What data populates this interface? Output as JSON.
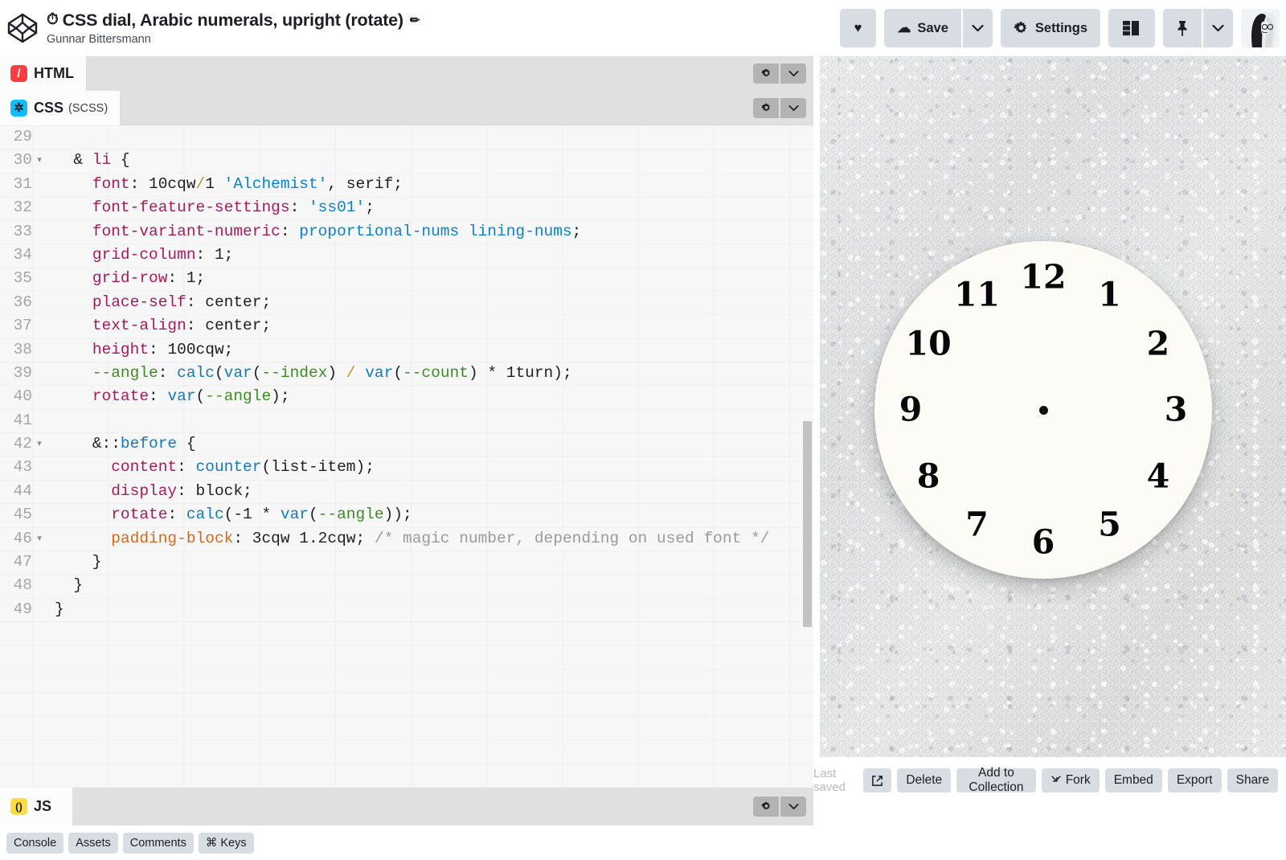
{
  "header": {
    "logo_icon": "codepen-logo-icon",
    "pen_title": "CSS dial, Arabic numerals, upright (rotate)",
    "stopwatch_icon": "⏱",
    "edit_icon": "✏",
    "author": "Gunnar Bittersmann",
    "actions": {
      "heart_icon": "♥",
      "save_label": "Save",
      "save_cloud_icon": "☁",
      "save_chevron": "⌄",
      "settings_label": "Settings",
      "settings_gear_icon": "✿",
      "layout_icon": "layout-icon",
      "pin_icon": "📌",
      "pin_chevron": "⌄",
      "avatar_alt": "user-avatar"
    }
  },
  "panes": [
    {
      "id": "html",
      "label": "HTML",
      "sub": "",
      "icon_glyph": "/",
      "icon_color": "#ff3c41"
    },
    {
      "id": "css",
      "label": "CSS",
      "sub": "(SCSS)",
      "icon_glyph": "✲",
      "icon_color": "#0ebeff"
    },
    {
      "id": "js",
      "label": "JS",
      "sub": "",
      "icon_glyph": "()",
      "icon_color": "#ffdd40"
    }
  ],
  "pane_controls": {
    "gear_icon": "✿",
    "chevron_icon": "⌄"
  },
  "editor": {
    "language": "SCSS",
    "first_line": 29,
    "lines": [
      {
        "n": 29,
        "fold": "",
        "tokens": []
      },
      {
        "n": 30,
        "fold": "▾",
        "tokens": [
          {
            "t": "  ",
            "c": "t-punct"
          },
          {
            "t": "&",
            "c": "t-punct"
          },
          {
            "t": " ",
            "c": "t-punct"
          },
          {
            "t": "li",
            "c": "t-sel"
          },
          {
            "t": " {",
            "c": "t-punct"
          }
        ]
      },
      {
        "n": 31,
        "fold": "",
        "tokens": [
          {
            "t": "    ",
            "c": "t-punct"
          },
          {
            "t": "font",
            "c": "t-prop"
          },
          {
            "t": ": ",
            "c": "t-punct"
          },
          {
            "t": "10cqw",
            "c": "t-num"
          },
          {
            "t": "/",
            "c": "t-op"
          },
          {
            "t": "1 ",
            "c": "t-num"
          },
          {
            "t": "'Alchemist'",
            "c": "t-str"
          },
          {
            "t": ", serif;",
            "c": "t-punct"
          }
        ]
      },
      {
        "n": 32,
        "fold": "",
        "tokens": [
          {
            "t": "    ",
            "c": "t-punct"
          },
          {
            "t": "font-feature-settings",
            "c": "t-prop"
          },
          {
            "t": ": ",
            "c": "t-punct"
          },
          {
            "t": "'ss01'",
            "c": "t-str"
          },
          {
            "t": ";",
            "c": "t-punct"
          }
        ]
      },
      {
        "n": 33,
        "fold": "",
        "tokens": [
          {
            "t": "    ",
            "c": "t-punct"
          },
          {
            "t": "font-variant-numeric",
            "c": "t-prop"
          },
          {
            "t": ": ",
            "c": "t-punct"
          },
          {
            "t": "proportional-nums lining-nums",
            "c": "t-val"
          },
          {
            "t": ";",
            "c": "t-punct"
          }
        ]
      },
      {
        "n": 34,
        "fold": "",
        "tokens": [
          {
            "t": "    ",
            "c": "t-punct"
          },
          {
            "t": "grid-column",
            "c": "t-prop"
          },
          {
            "t": ": ",
            "c": "t-punct"
          },
          {
            "t": "1;",
            "c": "t-num"
          }
        ]
      },
      {
        "n": 35,
        "fold": "",
        "tokens": [
          {
            "t": "    ",
            "c": "t-punct"
          },
          {
            "t": "grid-row",
            "c": "t-prop"
          },
          {
            "t": ": ",
            "c": "t-punct"
          },
          {
            "t": "1;",
            "c": "t-num"
          }
        ]
      },
      {
        "n": 36,
        "fold": "",
        "tokens": [
          {
            "t": "    ",
            "c": "t-punct"
          },
          {
            "t": "place-self",
            "c": "t-prop"
          },
          {
            "t": ": ",
            "c": "t-punct"
          },
          {
            "t": "center;",
            "c": "t-punct"
          }
        ]
      },
      {
        "n": 37,
        "fold": "",
        "tokens": [
          {
            "t": "    ",
            "c": "t-punct"
          },
          {
            "t": "text-align",
            "c": "t-prop"
          },
          {
            "t": ": ",
            "c": "t-punct"
          },
          {
            "t": "center;",
            "c": "t-punct"
          }
        ]
      },
      {
        "n": 38,
        "fold": "",
        "tokens": [
          {
            "t": "    ",
            "c": "t-punct"
          },
          {
            "t": "height",
            "c": "t-prop"
          },
          {
            "t": ": ",
            "c": "t-punct"
          },
          {
            "t": "100cqw;",
            "c": "t-num"
          }
        ]
      },
      {
        "n": 39,
        "fold": "",
        "tokens": [
          {
            "t": "    ",
            "c": "t-punct"
          },
          {
            "t": "--angle",
            "c": "t-var"
          },
          {
            "t": ": ",
            "c": "t-punct"
          },
          {
            "t": "calc",
            "c": "t-fn"
          },
          {
            "t": "(",
            "c": "t-punct"
          },
          {
            "t": "var",
            "c": "t-fn"
          },
          {
            "t": "(",
            "c": "t-punct"
          },
          {
            "t": "--index",
            "c": "t-var"
          },
          {
            "t": ") ",
            "c": "t-punct"
          },
          {
            "t": "/",
            "c": "t-op"
          },
          {
            "t": " ",
            "c": "t-punct"
          },
          {
            "t": "var",
            "c": "t-fn"
          },
          {
            "t": "(",
            "c": "t-punct"
          },
          {
            "t": "--count",
            "c": "t-var"
          },
          {
            "t": ") * 1turn);",
            "c": "t-punct"
          }
        ]
      },
      {
        "n": 40,
        "fold": "",
        "tokens": [
          {
            "t": "    ",
            "c": "t-punct"
          },
          {
            "t": "rotate",
            "c": "t-prop"
          },
          {
            "t": ": ",
            "c": "t-punct"
          },
          {
            "t": "var",
            "c": "t-fn"
          },
          {
            "t": "(",
            "c": "t-punct"
          },
          {
            "t": "--angle",
            "c": "t-var"
          },
          {
            "t": ");",
            "c": "t-punct"
          }
        ]
      },
      {
        "n": 41,
        "fold": "",
        "tokens": []
      },
      {
        "n": 42,
        "fold": "▾",
        "tokens": [
          {
            "t": "    ",
            "c": "t-punct"
          },
          {
            "t": "&::",
            "c": "t-punct"
          },
          {
            "t": "before",
            "c": "t-sel2"
          },
          {
            "t": " {",
            "c": "t-punct"
          }
        ]
      },
      {
        "n": 43,
        "fold": "",
        "tokens": [
          {
            "t": "      ",
            "c": "t-punct"
          },
          {
            "t": "content",
            "c": "t-prop"
          },
          {
            "t": ": ",
            "c": "t-punct"
          },
          {
            "t": "counter",
            "c": "t-fn"
          },
          {
            "t": "(list-item);",
            "c": "t-punct"
          }
        ]
      },
      {
        "n": 44,
        "fold": "",
        "tokens": [
          {
            "t": "      ",
            "c": "t-punct"
          },
          {
            "t": "display",
            "c": "t-prop"
          },
          {
            "t": ": ",
            "c": "t-punct"
          },
          {
            "t": "block;",
            "c": "t-punct"
          }
        ]
      },
      {
        "n": 45,
        "fold": "",
        "tokens": [
          {
            "t": "      ",
            "c": "t-punct"
          },
          {
            "t": "rotate",
            "c": "t-prop"
          },
          {
            "t": ": ",
            "c": "t-punct"
          },
          {
            "t": "calc",
            "c": "t-fn"
          },
          {
            "t": "(-1 * ",
            "c": "t-punct"
          },
          {
            "t": "var",
            "c": "t-fn"
          },
          {
            "t": "(",
            "c": "t-punct"
          },
          {
            "t": "--angle",
            "c": "t-var"
          },
          {
            "t": "));",
            "c": "t-punct"
          }
        ]
      },
      {
        "n": 46,
        "fold": "▾",
        "tokens": [
          {
            "t": "      ",
            "c": "t-punct"
          },
          {
            "t": "padding-block",
            "c": "t-propal"
          },
          {
            "t": ": ",
            "c": "t-punct"
          },
          {
            "t": "3cqw 1.2cqw;",
            "c": "t-num"
          },
          {
            "t": " /* magic number, depending on used font */",
            "c": "t-cmt"
          }
        ]
      },
      {
        "n": 47,
        "fold": "",
        "tokens": [
          {
            "t": "    }",
            "c": "t-punct"
          }
        ]
      },
      {
        "n": 48,
        "fold": "",
        "tokens": [
          {
            "t": "  }",
            "c": "t-punct"
          }
        ]
      },
      {
        "n": 49,
        "fold": "",
        "tokens": [
          {
            "t": "}",
            "c": "t-punct"
          }
        ]
      }
    ]
  },
  "utility_bar": {
    "buttons": [
      {
        "label": "Console",
        "icon": ""
      },
      {
        "label": "Assets",
        "icon": ""
      },
      {
        "label": "Comments",
        "icon": ""
      },
      {
        "label": "Keys",
        "icon": "⌘"
      }
    ]
  },
  "preview": {
    "background": "white-stucco-wall",
    "clock": {
      "face_color": "#fdfbf6",
      "numeral_color": "#07070a",
      "center_dot": true,
      "numerals": [
        "1",
        "2",
        "3",
        "4",
        "5",
        "6",
        "7",
        "8",
        "9",
        "10",
        "11",
        "12"
      ]
    }
  },
  "bottom_bar": {
    "last_saved_label": "Last saved",
    "buttons": [
      {
        "label": "",
        "icon": "↗",
        "name": "open-external-button"
      },
      {
        "label": "Delete",
        "icon": "",
        "name": "delete-button"
      },
      {
        "label": "Add to Collection",
        "icon": "",
        "name": "add-to-collection-button"
      },
      {
        "label": "Fork",
        "icon": "⑂",
        "name": "fork-button"
      },
      {
        "label": "Embed",
        "icon": "",
        "name": "embed-button"
      },
      {
        "label": "Export",
        "icon": "",
        "name": "export-button"
      },
      {
        "label": "Share",
        "icon": "",
        "name": "share-button"
      }
    ]
  },
  "colors": {
    "toolbar_button": "#d8dce3",
    "pane_header": "#e0e0e0",
    "editor_bg": "#f7f7f8",
    "html_red": "#ff3c41",
    "css_blue": "#0ebeff",
    "js_yellow": "#ffdd40"
  }
}
